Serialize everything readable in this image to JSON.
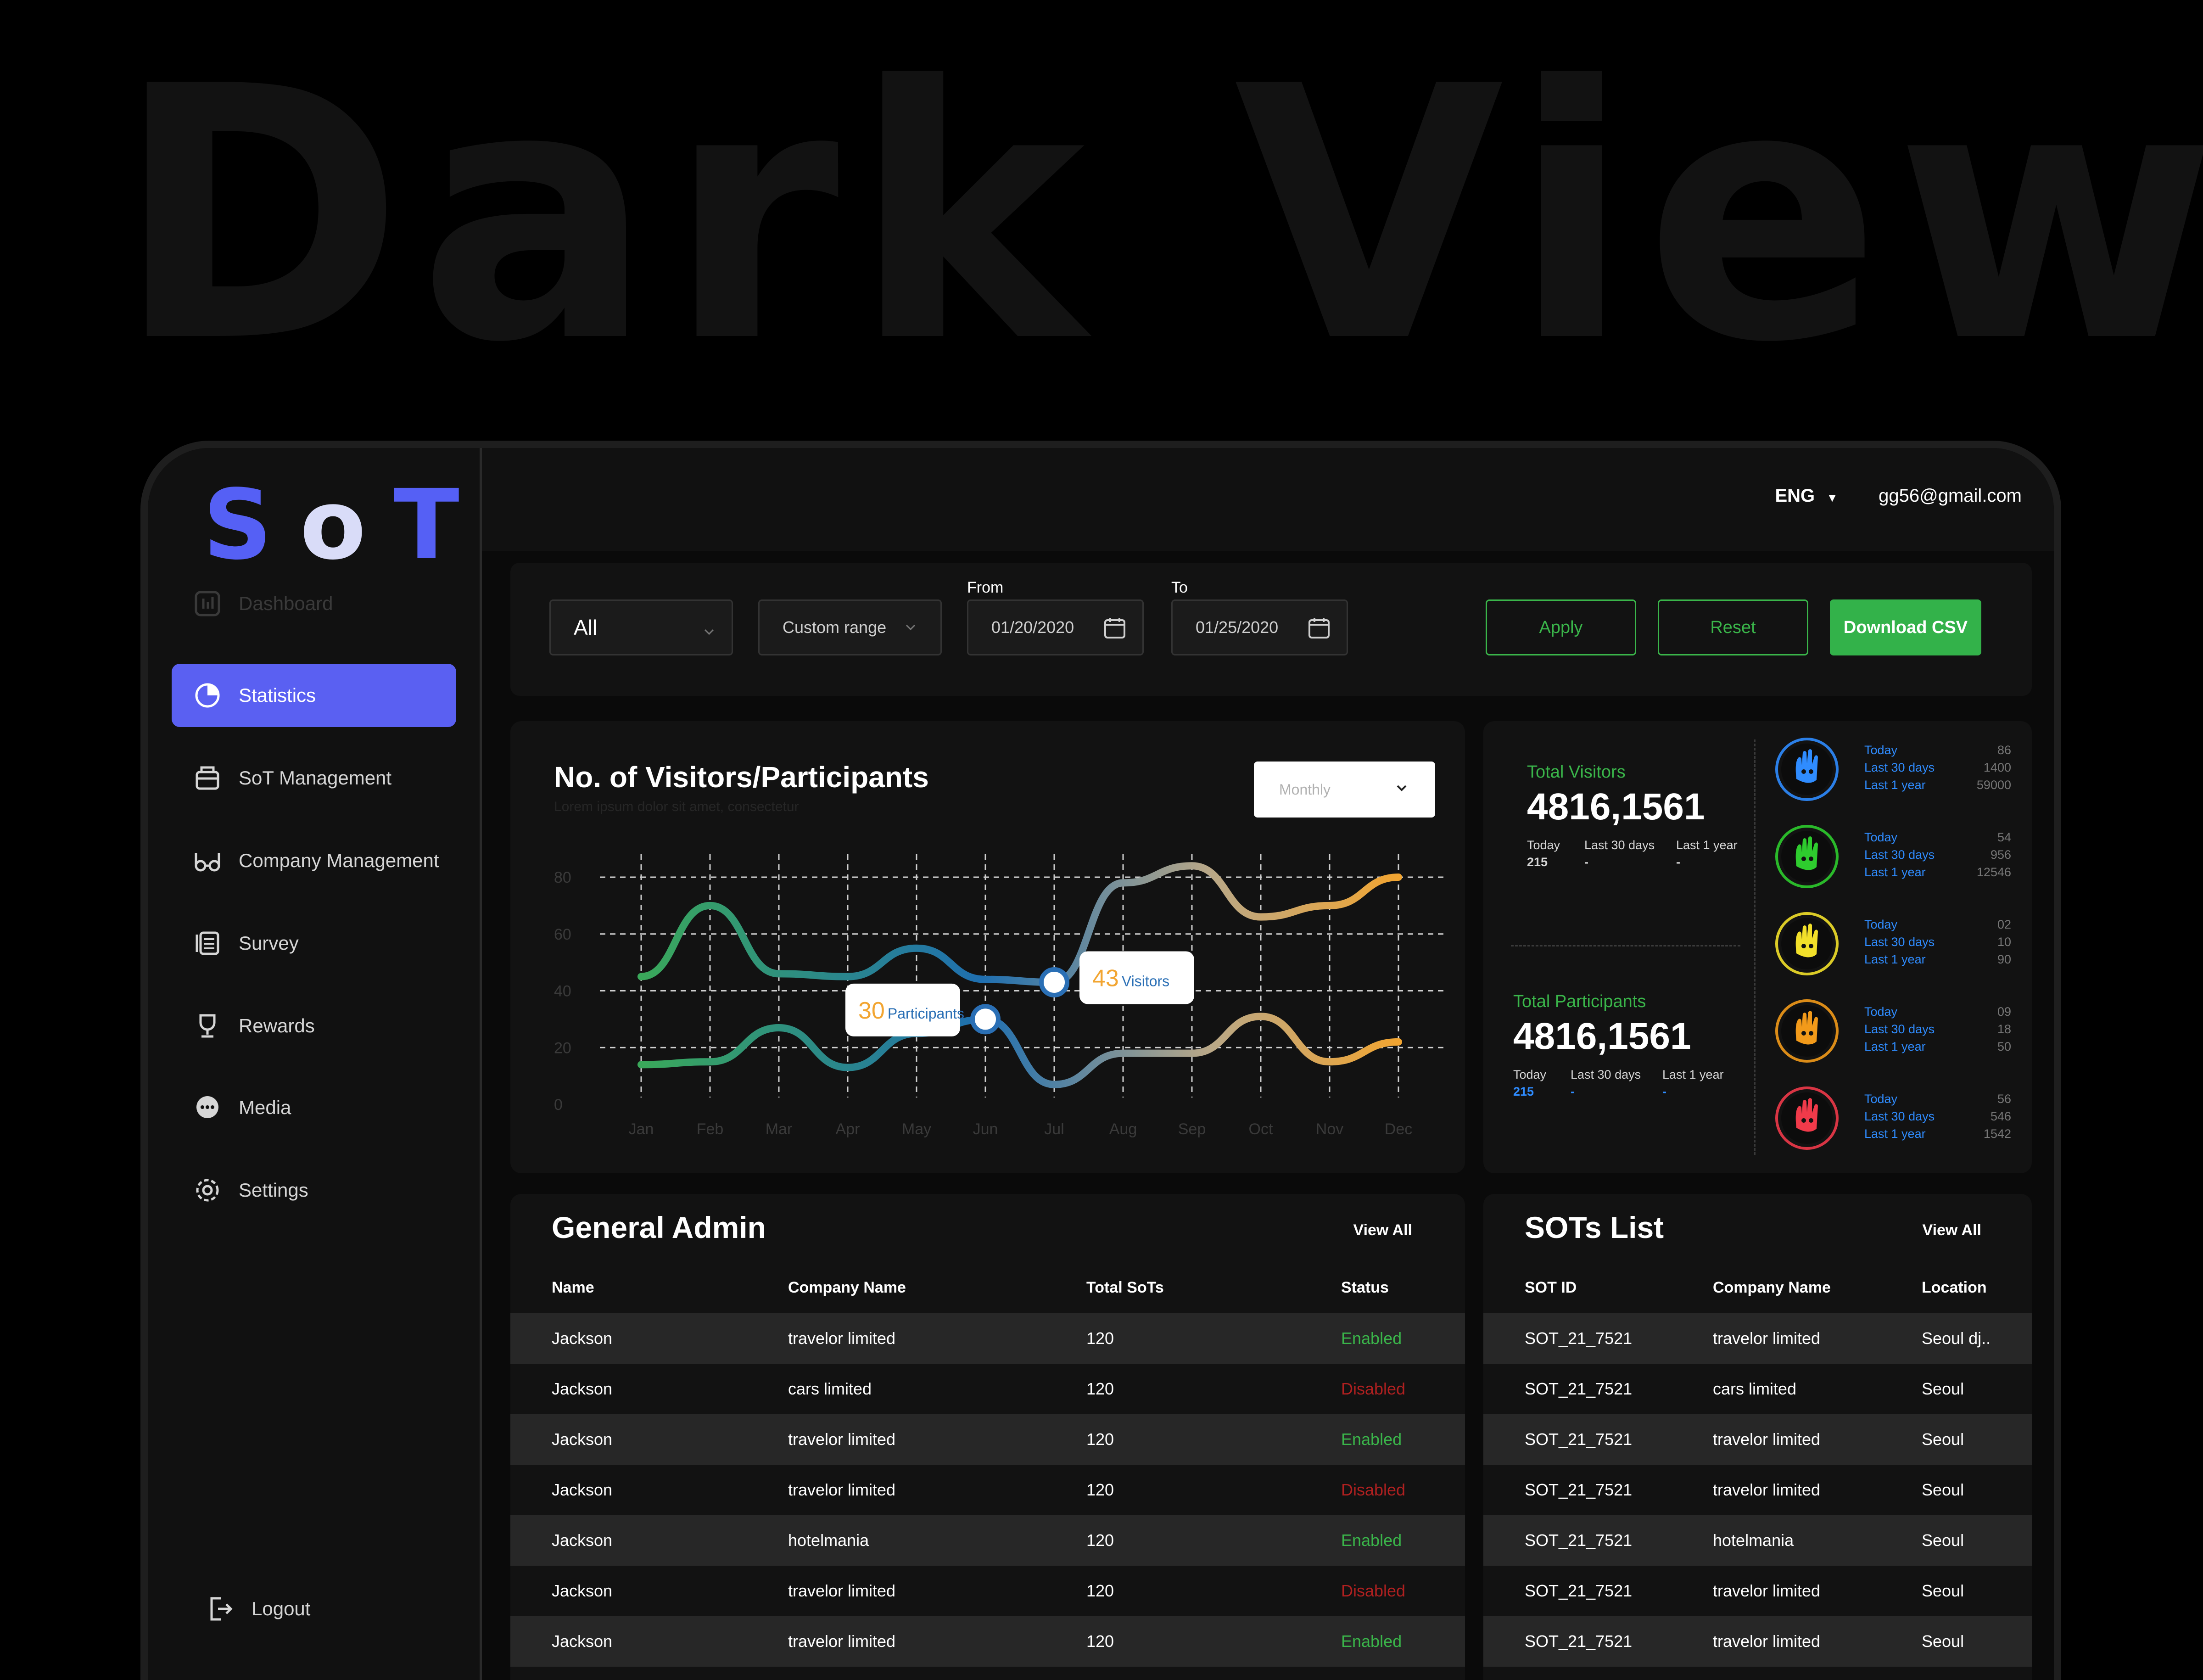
{
  "hero_title": "Dark View",
  "logo": {
    "l1": "S",
    "l2": "o",
    "l3": "T"
  },
  "sidebar": {
    "items": [
      {
        "label": "Dashboard"
      },
      {
        "label": "Statistics"
      },
      {
        "label": "SoT Management"
      },
      {
        "label": "Company Management"
      },
      {
        "label": "Survey"
      },
      {
        "label": "Rewards"
      },
      {
        "label": "Media"
      },
      {
        "label": "Settings"
      }
    ],
    "logout": "Logout"
  },
  "header": {
    "language": "ENG",
    "email": "gg56@gmail.com"
  },
  "filters": {
    "type_value": "All",
    "range_value": "Custom range",
    "from_label": "From",
    "from_value": "01/20/2020",
    "to_label": "To",
    "to_value": "01/25/2020",
    "apply": "Apply",
    "reset": "Reset",
    "download": "Download CSV"
  },
  "chart_data": {
    "type": "line",
    "title": "No. of Visitors/Participants",
    "subtitle": "Lorem ipsum dolor sit amet, consectetur",
    "period_select": "Monthly",
    "categories": [
      "Jan",
      "Feb",
      "Mar",
      "Apr",
      "May",
      "Jun",
      "Jul",
      "Aug",
      "Sep",
      "Oct",
      "Nov",
      "Dec"
    ],
    "ylim": [
      0,
      80
    ],
    "yticks": [
      0,
      20,
      40,
      60,
      80
    ],
    "grid": true,
    "series": [
      {
        "name": "Visitors",
        "values": [
          45,
          70,
          46,
          45,
          55,
          44,
          43,
          78,
          84,
          66,
          70,
          80
        ]
      },
      {
        "name": "Participants",
        "values": [
          14,
          15,
          27,
          13,
          25,
          30,
          7,
          18,
          18,
          31,
          15,
          22
        ]
      }
    ],
    "annotations": [
      {
        "series": "Participants",
        "category": "Jun",
        "value": "30",
        "label": "Participants"
      },
      {
        "series": "Visitors",
        "category": "Jul",
        "value": "43",
        "label": "Visitors"
      }
    ]
  },
  "stats": {
    "visitors": {
      "label": "Total Visitors",
      "value": "4816,1561",
      "today_label": "Today",
      "today": "215",
      "d30_label": "Last 30 days",
      "d30": "-",
      "y1_label": "Last 1 year",
      "y1": "-"
    },
    "participants": {
      "label": "Total Participants",
      "value": "4816,1561",
      "today_label": "Today",
      "today": "215",
      "d30_label": "Last 30 days",
      "d30": "-",
      "y1_label": "Last 1 year",
      "y1": "-"
    },
    "moods": [
      {
        "icon": "blue-hand-icon",
        "color": "#2f8cff",
        "today": "86",
        "d30": "1400",
        "y1": "59000"
      },
      {
        "icon": "green-hand-icon",
        "color": "#2ecc2e",
        "today": "54",
        "d30": "956",
        "y1": "12546"
      },
      {
        "icon": "yellow-hand-icon",
        "color": "#f2e02a",
        "today": "02",
        "d30": "10",
        "y1": "90"
      },
      {
        "icon": "orange-hand-icon",
        "color": "#f29a1a",
        "today": "09",
        "d30": "18",
        "y1": "50"
      },
      {
        "icon": "red-hand-icon",
        "color": "#f03a4a",
        "today": "56",
        "d30": "546",
        "y1": "1542"
      }
    ],
    "mood_labels": {
      "today": "Today",
      "d30": "Last 30 days",
      "y1": "Last 1 year"
    }
  },
  "admin": {
    "title": "General Admin",
    "view_all": "View All",
    "headers": [
      "Name",
      "Company Name",
      "Total SoTs",
      "Status"
    ],
    "rows": [
      [
        "Jackson",
        "travelor limited",
        "120",
        "Enabled"
      ],
      [
        "Jackson",
        "cars limited",
        "120",
        "Disabled"
      ],
      [
        "Jackson",
        "travelor limited",
        "120",
        "Enabled"
      ],
      [
        "Jackson",
        "travelor limited",
        "120",
        "Disabled"
      ],
      [
        "Jackson",
        "hotelmania",
        "120",
        "Enabled"
      ],
      [
        "Jackson",
        "travelor limited",
        "120",
        "Disabled"
      ],
      [
        "Jackson",
        "travelor limited",
        "120",
        "Enabled"
      ]
    ]
  },
  "sots": {
    "title": "SOTs List",
    "view_all": "View All",
    "headers": [
      "SOT ID",
      "Company Name",
      "Location"
    ],
    "rows": [
      [
        "SOT_21_7521",
        "travelor limited",
        "Seoul dj.."
      ],
      [
        "SOT_21_7521",
        "cars limited",
        "Seoul"
      ],
      [
        "SOT_21_7521",
        "travelor limited",
        "Seoul"
      ],
      [
        "SOT_21_7521",
        "travelor limited",
        "Seoul"
      ],
      [
        "SOT_21_7521",
        "hotelmania",
        "Seoul"
      ],
      [
        "SOT_21_7521",
        "travelor limited",
        "Seoul"
      ],
      [
        "SOT_21_7521",
        "travelor limited",
        "Seoul"
      ]
    ]
  },
  "colors": {
    "accent": "#5a60f2",
    "green": "#3ab54a",
    "red": "#b02020",
    "blue": "#2f8cff"
  }
}
